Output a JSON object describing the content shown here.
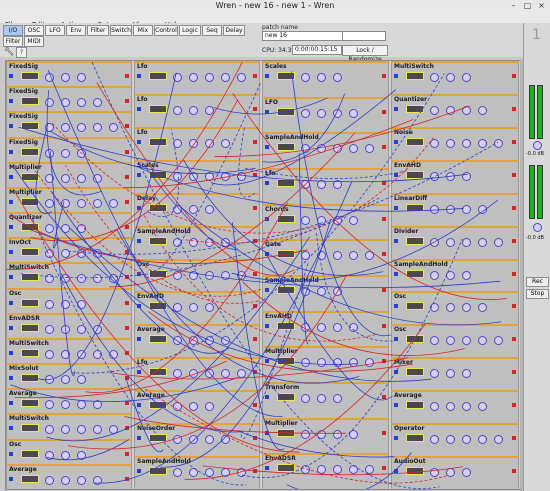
{
  "window": {
    "title": "Wren - new 16 - new 1 - Wren"
  },
  "menu": [
    "File",
    "Edit",
    "Action",
    "Setup",
    "View",
    "Help"
  ],
  "toolbar": {
    "tabs": [
      "I/O",
      "OSC",
      "LFO",
      "Env",
      "Filter",
      "Switch",
      "Mix",
      "Control",
      "Logic",
      "Seq",
      "Delay"
    ],
    "small_buttons": [
      "Filter",
      "MIDI"
    ],
    "patch_name_label": "patch name",
    "patch_name": "new 16",
    "cpu_label": "CPU: 34.3%",
    "time": "0:00:00:15:15",
    "randomize_label": "Lock / Randomize",
    "version": "1"
  },
  "right_panel": {
    "labels": [
      "-0.0 dB",
      "-0.0 dB"
    ],
    "buttons": [
      "Rec",
      "Stop"
    ]
  },
  "modules": [
    {
      "name": "FixedSig",
      "col": 0,
      "row": 0
    },
    {
      "name": "FixedSig",
      "col": 0,
      "row": 1
    },
    {
      "name": "FixedSig",
      "col": 0,
      "row": 2
    },
    {
      "name": "FixedSig",
      "col": 0,
      "row": 3
    },
    {
      "name": "Multiplier",
      "col": 0,
      "row": 4
    },
    {
      "name": "Multiplier",
      "col": 0,
      "row": 5
    },
    {
      "name": "Quantizer",
      "col": 0,
      "row": 6
    },
    {
      "name": "InvOct",
      "col": 0,
      "row": 7
    },
    {
      "name": "MultiSwitch",
      "col": 0,
      "row": 8
    },
    {
      "name": "Osc",
      "col": 0,
      "row": 9
    },
    {
      "name": "EnvADSR",
      "col": 0,
      "row": 10
    },
    {
      "name": "MultiSwitch",
      "col": 0,
      "row": 11
    },
    {
      "name": "MixSolut",
      "col": 0,
      "row": 12
    },
    {
      "name": "Average",
      "col": 0,
      "row": 13
    },
    {
      "name": "MultiSwitch",
      "col": 0,
      "row": 14
    },
    {
      "name": "Osc",
      "col": 0,
      "row": 15
    },
    {
      "name": "Average",
      "col": 0,
      "row": 16
    },
    {
      "name": "Lfo",
      "col": 1,
      "row": 0
    },
    {
      "name": "Lfo",
      "col": 1,
      "row": 1
    },
    {
      "name": "Lfo",
      "col": 1,
      "row": 2
    },
    {
      "name": "Scales",
      "col": 1,
      "row": 3
    },
    {
      "name": "Delay",
      "col": 1,
      "row": 4
    },
    {
      "name": "SampleAndHold",
      "col": 1,
      "row": 5
    },
    {
      "name": "Osc",
      "col": 1,
      "row": 6
    },
    {
      "name": "EnvAHD",
      "col": 1,
      "row": 7
    },
    {
      "name": "Average",
      "col": 1,
      "row": 8
    },
    {
      "name": "Lfo",
      "col": 1,
      "row": 9
    },
    {
      "name": "Average",
      "col": 1,
      "row": 10
    },
    {
      "name": "NoiseOrder",
      "col": 1,
      "row": 11
    },
    {
      "name": "SampleAndHold",
      "col": 1,
      "row": 12
    },
    {
      "name": "Scales",
      "col": 2,
      "row": 0
    },
    {
      "name": "LFO",
      "col": 2,
      "row": 1
    },
    {
      "name": "SampleAndHold",
      "col": 2,
      "row": 2
    },
    {
      "name": "Lfo",
      "col": 2,
      "row": 3
    },
    {
      "name": "Chords",
      "col": 2,
      "row": 4
    },
    {
      "name": "Gate",
      "col": 2,
      "row": 5
    },
    {
      "name": "SampleAndHold",
      "col": 2,
      "row": 6
    },
    {
      "name": "EnvAHD",
      "col": 2,
      "row": 7
    },
    {
      "name": "Multiplier",
      "col": 2,
      "row": 8
    },
    {
      "name": "Transform",
      "col": 2,
      "row": 9
    },
    {
      "name": "Multiplier",
      "col": 2,
      "row": 10
    },
    {
      "name": "EnvADSR",
      "col": 2,
      "row": 11
    },
    {
      "name": "MultiSwitch",
      "col": 3,
      "row": 0
    },
    {
      "name": "Quantizer",
      "col": 3,
      "row": 1
    },
    {
      "name": "Noise",
      "col": 3,
      "row": 2
    },
    {
      "name": "EnvAHD",
      "col": 3,
      "row": 3
    },
    {
      "name": "LinearDiff",
      "col": 3,
      "row": 4
    },
    {
      "name": "Divider",
      "col": 3,
      "row": 5
    },
    {
      "name": "SampleAndHold",
      "col": 3,
      "row": 6
    },
    {
      "name": "Osc",
      "col": 3,
      "row": 7
    },
    {
      "name": "Osc",
      "col": 3,
      "row": 8
    },
    {
      "name": "Mixer",
      "col": 3,
      "row": 9
    },
    {
      "name": "Average",
      "col": 3,
      "row": 10
    },
    {
      "name": "Operator",
      "col": 3,
      "row": 11
    },
    {
      "name": "AudioOut",
      "col": 3,
      "row": 12
    }
  ]
}
